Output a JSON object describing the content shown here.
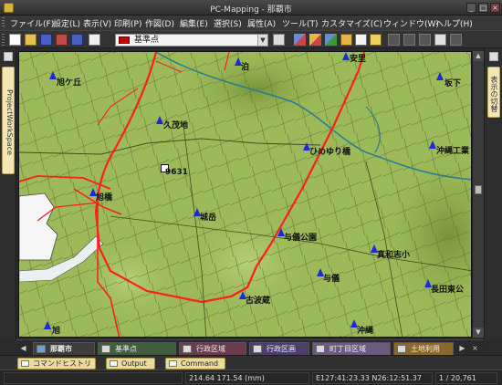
{
  "window": {
    "title": "PC-Mapping - 那覇市",
    "minimize": "_",
    "maximize": "□",
    "close": "×"
  },
  "menu": [
    "ファイル(F)",
    "設定(L)",
    "表示(V)",
    "印刷(P)",
    "作図(D)",
    "編集(E)",
    "選択(S)",
    "属性(A)",
    "ツール(T)",
    "カスタマイズ(C)",
    "ウィンドウ(W)",
    "ヘルプ(H)"
  ],
  "toolbar": {
    "layer_select_value": "基準点"
  },
  "side_tabs": {
    "left": "ProjectWorkSpace",
    "right": "表示の切替"
  },
  "map": {
    "labels": [
      "安里",
      "泊",
      "旭ケ丘",
      "坂下",
      "久茂地",
      "ひめゆり橋",
      "沖縄工業",
      "9631",
      "旭橋",
      "城岳",
      "与儀公園",
      "真和志小",
      "与儀",
      "長田東公",
      "古波蔵",
      "旭",
      "沖縄"
    ]
  },
  "tabs": {
    "active": "那覇市",
    "others": [
      "基準点",
      "行政区域",
      "行政区画",
      "町丁目区域",
      "土地利用"
    ]
  },
  "bottom_panels": [
    "コマンドヒストリー",
    "Output",
    "Command"
  ],
  "status": {
    "scale": "214.64 171.54 (mm)",
    "coords": "E127:41:23.33 N26:12:51.37",
    "page": "1 / 20,761"
  },
  "colors": {
    "map_base": "#9cba59",
    "road_major": "#ff1e1e",
    "road_minor": "#6b7a3e",
    "water": "#2f7e8f",
    "marker": "#1a2bd8",
    "panel_tab": "#f2e6b4"
  }
}
